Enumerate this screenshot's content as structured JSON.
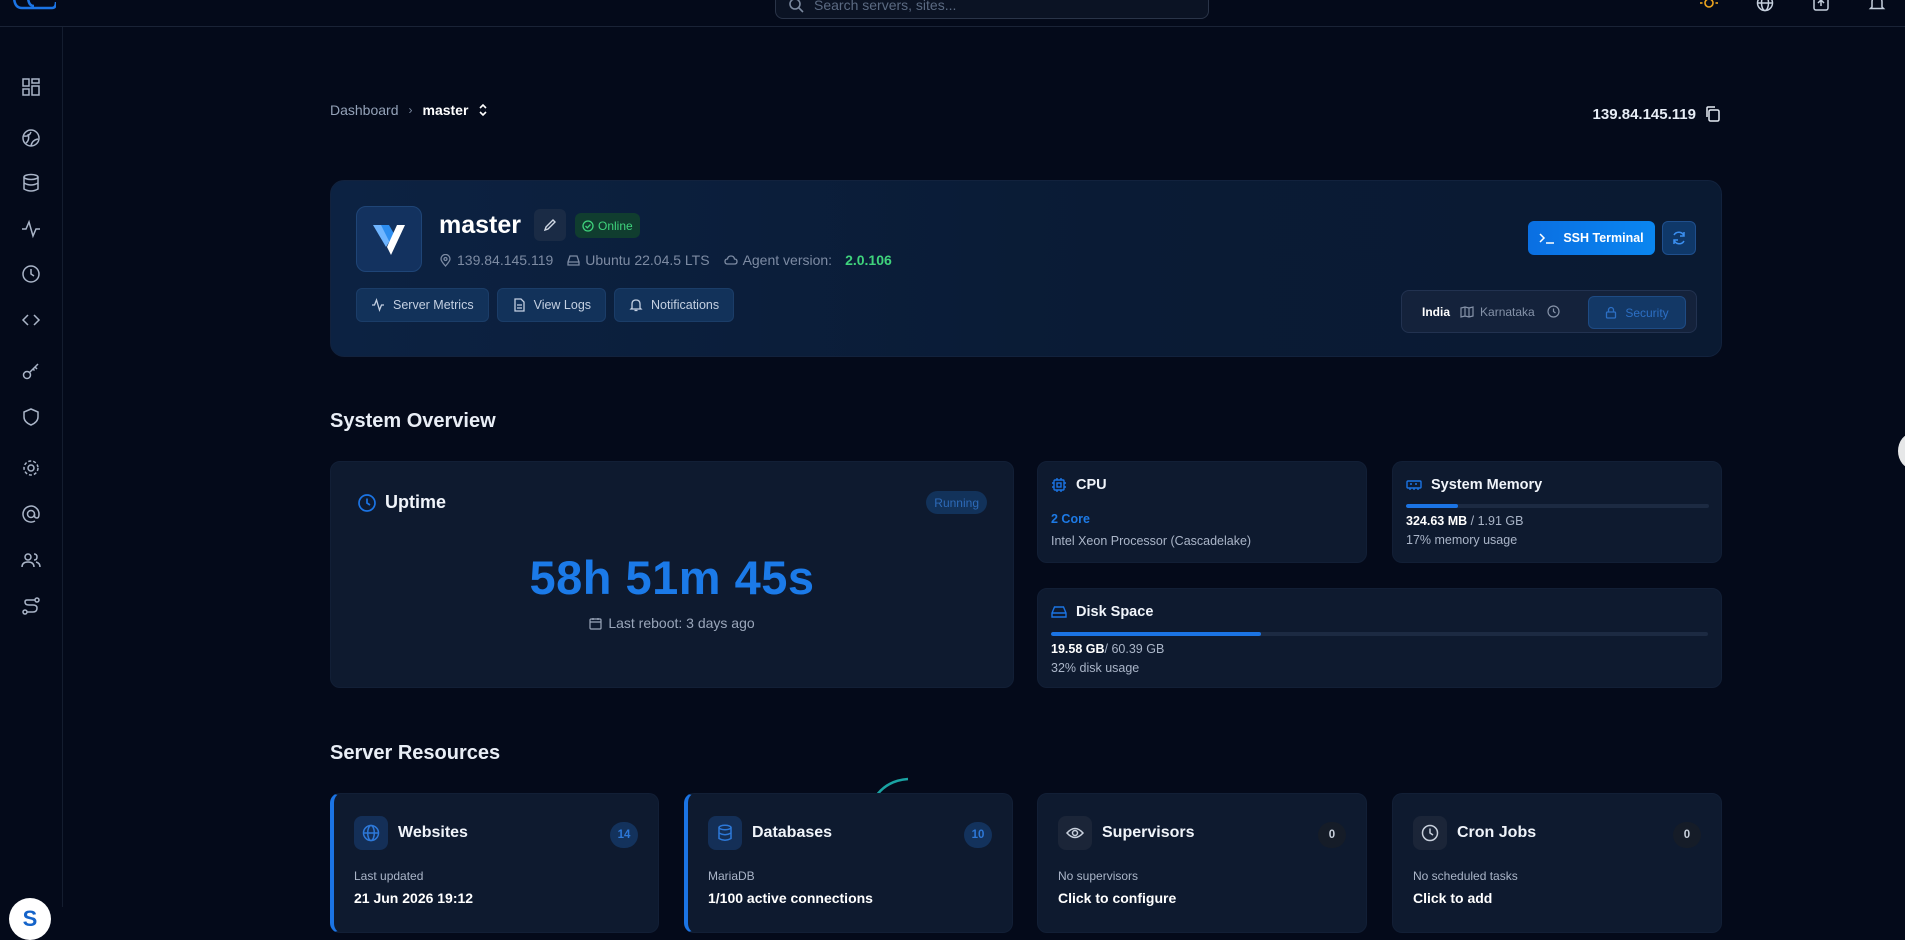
{
  "search": {
    "placeholder": "Search servers, sites..."
  },
  "breadcrumb": {
    "root": "Dashboard",
    "current": "master"
  },
  "server": {
    "ip": "139.84.145.119",
    "name": "master",
    "status": "Online",
    "os": "Ubuntu 22.04.5 LTS",
    "agent_label": "Agent version:",
    "agent_version": "2.0.106",
    "actions": [
      "Server Metrics",
      "View Logs",
      "Notifications"
    ],
    "ssh_label": "SSH Terminal",
    "location": {
      "country": "India",
      "region": "Karnataka",
      "security_label": "Security"
    }
  },
  "overview": {
    "title": "System Overview",
    "uptime": {
      "title": "Uptime",
      "status": "Running",
      "value": "58h 51m 45s",
      "last_reboot": "Last reboot: 3 days ago"
    },
    "cpu": {
      "title": "CPU",
      "cores": "2 Core",
      "model": "Intel Xeon Processor (Cascadelake)"
    },
    "memory": {
      "title": "System Memory",
      "used": "324.63 MB",
      "total": " / 1.91 GB",
      "usage_text": "17% memory usage",
      "percent": 17
    },
    "disk": {
      "title": "Disk Space",
      "used": "19.58 GB",
      "total": "/ 60.39 GB",
      "usage_text": "32% disk usage",
      "percent": 32
    }
  },
  "resources": {
    "title": "Server Resources",
    "websites": {
      "title": "Websites",
      "count": "14",
      "sub": "Last updated",
      "main": "21 Jun 2026 19:12"
    },
    "databases": {
      "title": "Databases",
      "count": "10",
      "sub": "MariaDB",
      "main": "1/100 active connections"
    },
    "supervisors": {
      "title": "Supervisors",
      "count": "0",
      "sub": "No supervisors",
      "main": "Click to configure"
    },
    "cron": {
      "title": "Cron Jobs",
      "count": "0",
      "sub": "No scheduled tasks",
      "main": "Click to add"
    }
  },
  "user": {
    "initial": "S"
  },
  "colors": {
    "accent": "#1b74e4",
    "online": "#3fd37c",
    "background": "#040a1a"
  }
}
